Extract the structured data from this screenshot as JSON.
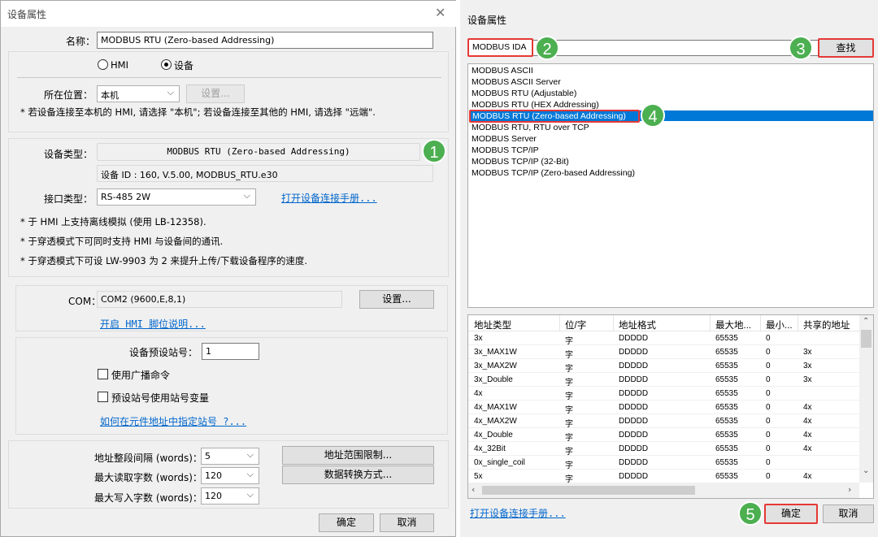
{
  "left_dialog": {
    "title": "设备属性",
    "name_label": "名称：",
    "name_value": "MODBUS RTU (Zero-based Addressing)",
    "radio_hmi": "HMI",
    "radio_device": "设备",
    "location_label": "所在位置：",
    "location_value": "本机",
    "location_settings_btn": "设置...",
    "location_note": "* 若设备连接至本机的 HMI, 请选择 \"本机\"; 若设备连接至其他的 HMI, 请选择 \"远端\".",
    "device_type_label": "设备类型：",
    "device_type_value": "MODBUS RTU (Zero-based Addressing)",
    "device_id": "设备 ID : 160, V.5.00, MODBUS_RTU.e30",
    "interface_label": "接口类型：",
    "interface_value": "RS-485 2W",
    "manual_link": "打开设备连接手册...",
    "notes": [
      "* 于 HMI 上支持离线模拟 (使用 LB-12358).",
      "* 于穿透模式下可同时支持 HMI 与设备间的通讯.",
      "* 于穿透模式下可设 LW-9903 为 2 来提升上传/下载设备程序的速度."
    ],
    "com_label": "COM：",
    "com_value": "COM2 (9600,E,8,1)",
    "com_settings_btn": "设置...",
    "hmi_pin_link": "开启 HMI 脚位说明...",
    "station_label": "设备预设站号：",
    "station_value": "1",
    "broadcast_label": "使用广播命令",
    "station_var_label": "预设站号使用站号变量",
    "station_link": "如何在元件地址中指定站号 ?...",
    "addr_interval_label": "地址整段间隔 (words)：",
    "addr_interval_value": "5",
    "max_read_label": "最大读取字数 (words)：",
    "max_read_value": "120",
    "max_write_label": "最大写入字数 (words)：",
    "max_write_value": "120",
    "addr_limit_btn": "地址范围限制...",
    "data_conv_btn": "数据转换方式...",
    "ok_btn": "确定",
    "cancel_btn": "取消",
    "badge_1": "1"
  },
  "right_panel": {
    "title": "设备属性",
    "search_value": "MODBUS IDA",
    "find_btn": "查找",
    "list_items": [
      "MODBUS ASCII",
      "MODBUS ASCII Server",
      "MODBUS RTU (Adjustable)",
      "MODBUS RTU (HEX Addressing)",
      "MODBUS RTU (Zero-based Addressing)",
      "MODBUS RTU, RTU over TCP",
      "MODBUS Server",
      "MODBUS TCP/IP",
      "MODBUS TCP/IP (32-Bit)",
      "MODBUS TCP/IP (Zero-based Addressing)"
    ],
    "selected_index": 4,
    "table_headers": [
      "地址类型",
      "位/字",
      "地址格式",
      "最大地...",
      "最小...",
      "共享的地址"
    ],
    "table_rows": [
      [
        "3x",
        "字",
        "DDDDD",
        "65535",
        "0",
        ""
      ],
      [
        "3x_MAX1W",
        "字",
        "DDDDD",
        "65535",
        "0",
        "3x"
      ],
      [
        "3x_MAX2W",
        "字",
        "DDDDD",
        "65535",
        "0",
        "3x"
      ],
      [
        "3x_Double",
        "字",
        "DDDDD",
        "65535",
        "0",
        "3x"
      ],
      [
        "4x",
        "字",
        "DDDDD",
        "65535",
        "0",
        ""
      ],
      [
        "4x_MAX1W",
        "字",
        "DDDDD",
        "65535",
        "0",
        "4x"
      ],
      [
        "4x_MAX2W",
        "字",
        "DDDDD",
        "65535",
        "0",
        "4x"
      ],
      [
        "4x_Double",
        "字",
        "DDDDD",
        "65535",
        "0",
        "4x"
      ],
      [
        "4x_32Bit",
        "字",
        "DDDDD",
        "65535",
        "0",
        "4x"
      ],
      [
        "0x_single_coil",
        "字",
        "DDDDD",
        "65535",
        "0",
        ""
      ],
      [
        "5x",
        "字",
        "DDDDD",
        "65535",
        "0",
        "4x"
      ]
    ],
    "manual_link": "打开设备连接手册...",
    "ok_btn": "确定",
    "cancel_btn": "取消",
    "badge_2": "2",
    "badge_3": "3",
    "badge_4": "4",
    "badge_5": "5"
  },
  "colors": {
    "highlight_red": "#e53935",
    "badge_green": "#4caf50",
    "selection_blue": "#0078d7",
    "link_blue": "#0066cc"
  }
}
